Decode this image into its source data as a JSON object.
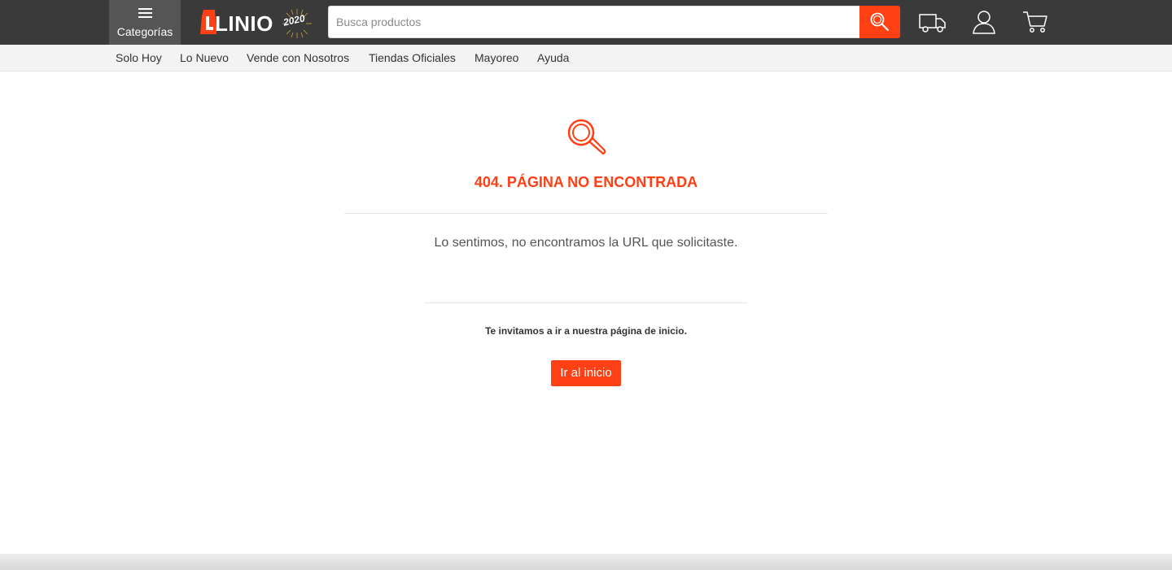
{
  "header": {
    "categories_label": "Categorías",
    "logo_text": "LINIO",
    "logo_badge": "2020",
    "search_placeholder": "Busca productos",
    "icons": [
      "truck-icon",
      "user-icon",
      "cart-icon"
    ]
  },
  "nav": {
    "items": [
      "Solo Hoy",
      "Lo Nuevo",
      "Vende con Nosotros",
      "Tiendas Oficiales",
      "Mayoreo",
      "Ayuda"
    ]
  },
  "error": {
    "title": "404. PÁGINA NO ENCONTRADA",
    "message": "Lo sentimos, no encontramos la URL que solicitaste.",
    "invite": "Te invitamos a ir a nuestra página de inicio.",
    "button_label": "Ir al inicio"
  },
  "colors": {
    "accent": "#ff3f14",
    "header_bg": "#3a3a3a",
    "nav_bg": "#f3f3f3"
  }
}
